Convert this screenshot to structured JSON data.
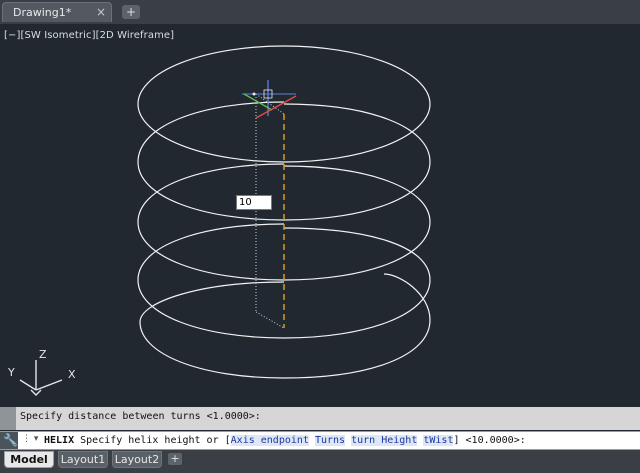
{
  "colors": {
    "background": "#212830",
    "helix": "#f2f2f2",
    "axis_dashed": "#e3a327",
    "crosshair_red": "#e84a4a",
    "crosshair_green": "#5bc24f",
    "crosshair_blue": "#5f7fe0"
  },
  "tabs": {
    "doc_tab": "Drawing1*",
    "close_glyph": "×",
    "new_tab_glyph": "+"
  },
  "viewport": {
    "label": "[−][SW Isometric][2D Wireframe]",
    "dynamic_input_value": "10"
  },
  "ucs": {
    "x": "X",
    "y": "Y",
    "z": "Z"
  },
  "command": {
    "history": "Specify distance between turns <1.0000>:",
    "dropdown_glyph": "⋮ ▾",
    "name": "HELIX",
    "prompt": " Specify helix height or [",
    "opt_axis": "Axis endpoint",
    "opt_turns": "Turns",
    "opt_turnheight": "turn Height",
    "opt_twist": "tWist",
    "suffix": "] <10.0000>:"
  },
  "layout_tabs": {
    "model": "Model",
    "layout1": "Layout1",
    "layout2": "Layout2",
    "add_glyph": "+"
  },
  "icons": {
    "wrench": "wrench-icon",
    "close": "close-icon"
  }
}
